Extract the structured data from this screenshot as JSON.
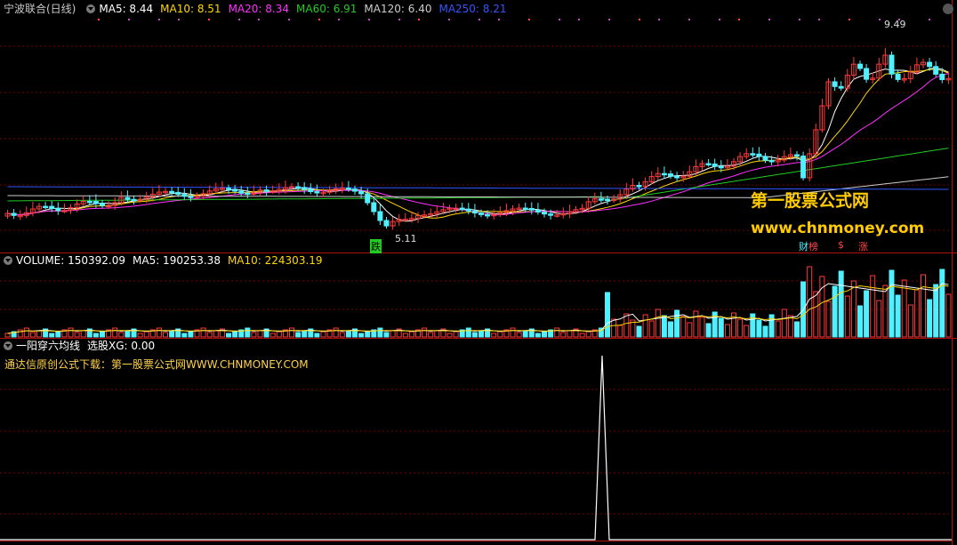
{
  "colors": {
    "up": "#ff3b3b",
    "down": "#4ff0ff",
    "frame": "#b01010",
    "grid": "#7a0000",
    "ma5": "#ffffff",
    "ma10": "#ffd700",
    "ma20": "#ff30ff",
    "ma60": "#22cc22",
    "ma120": "#cccccc",
    "ma250": "#3355ff"
  },
  "price_panel": {
    "title": "宁波联合(日线)",
    "indicators": [
      {
        "label": "MA5: 8.44",
        "color": "#ffffff"
      },
      {
        "label": "MA10: 8.51",
        "color": "#ffd700"
      },
      {
        "label": "MA20: 8.34",
        "color": "#ff30ff"
      },
      {
        "label": "MA60: 6.91",
        "color": "#22cc22"
      },
      {
        "label": "MA120: 6.40",
        "color": "#cccccc"
      },
      {
        "label": "MA250: 8.21",
        "color": "#3355ff"
      }
    ],
    "high_label": "9.49",
    "low_label": "5.11",
    "signal_down": "跌",
    "signal_rise": "涨",
    "signal_fin": "财",
    "signal_list": "榜",
    "signal_s": "$"
  },
  "volume_panel": {
    "indicators": [
      {
        "label": "VOLUME: 150392.09",
        "color": "#ffffff"
      },
      {
        "label": "MA5: 190253.38",
        "color": "#ffffff"
      },
      {
        "label": "MA10: 224303.19",
        "color": "#ffd700"
      }
    ]
  },
  "formula_panel": {
    "indicators": [
      {
        "label": "一阳穿六均线",
        "color": "#ffffff"
      },
      {
        "label": "选股XG: 0.00",
        "color": "#ffffff"
      }
    ],
    "notice": "通达信原创公式下载：第一股票公式网WWW.CHNMONEY.COM"
  },
  "watermark": {
    "line1": "第一股票公式网",
    "line2": "www.chnmoney.com"
  }
}
